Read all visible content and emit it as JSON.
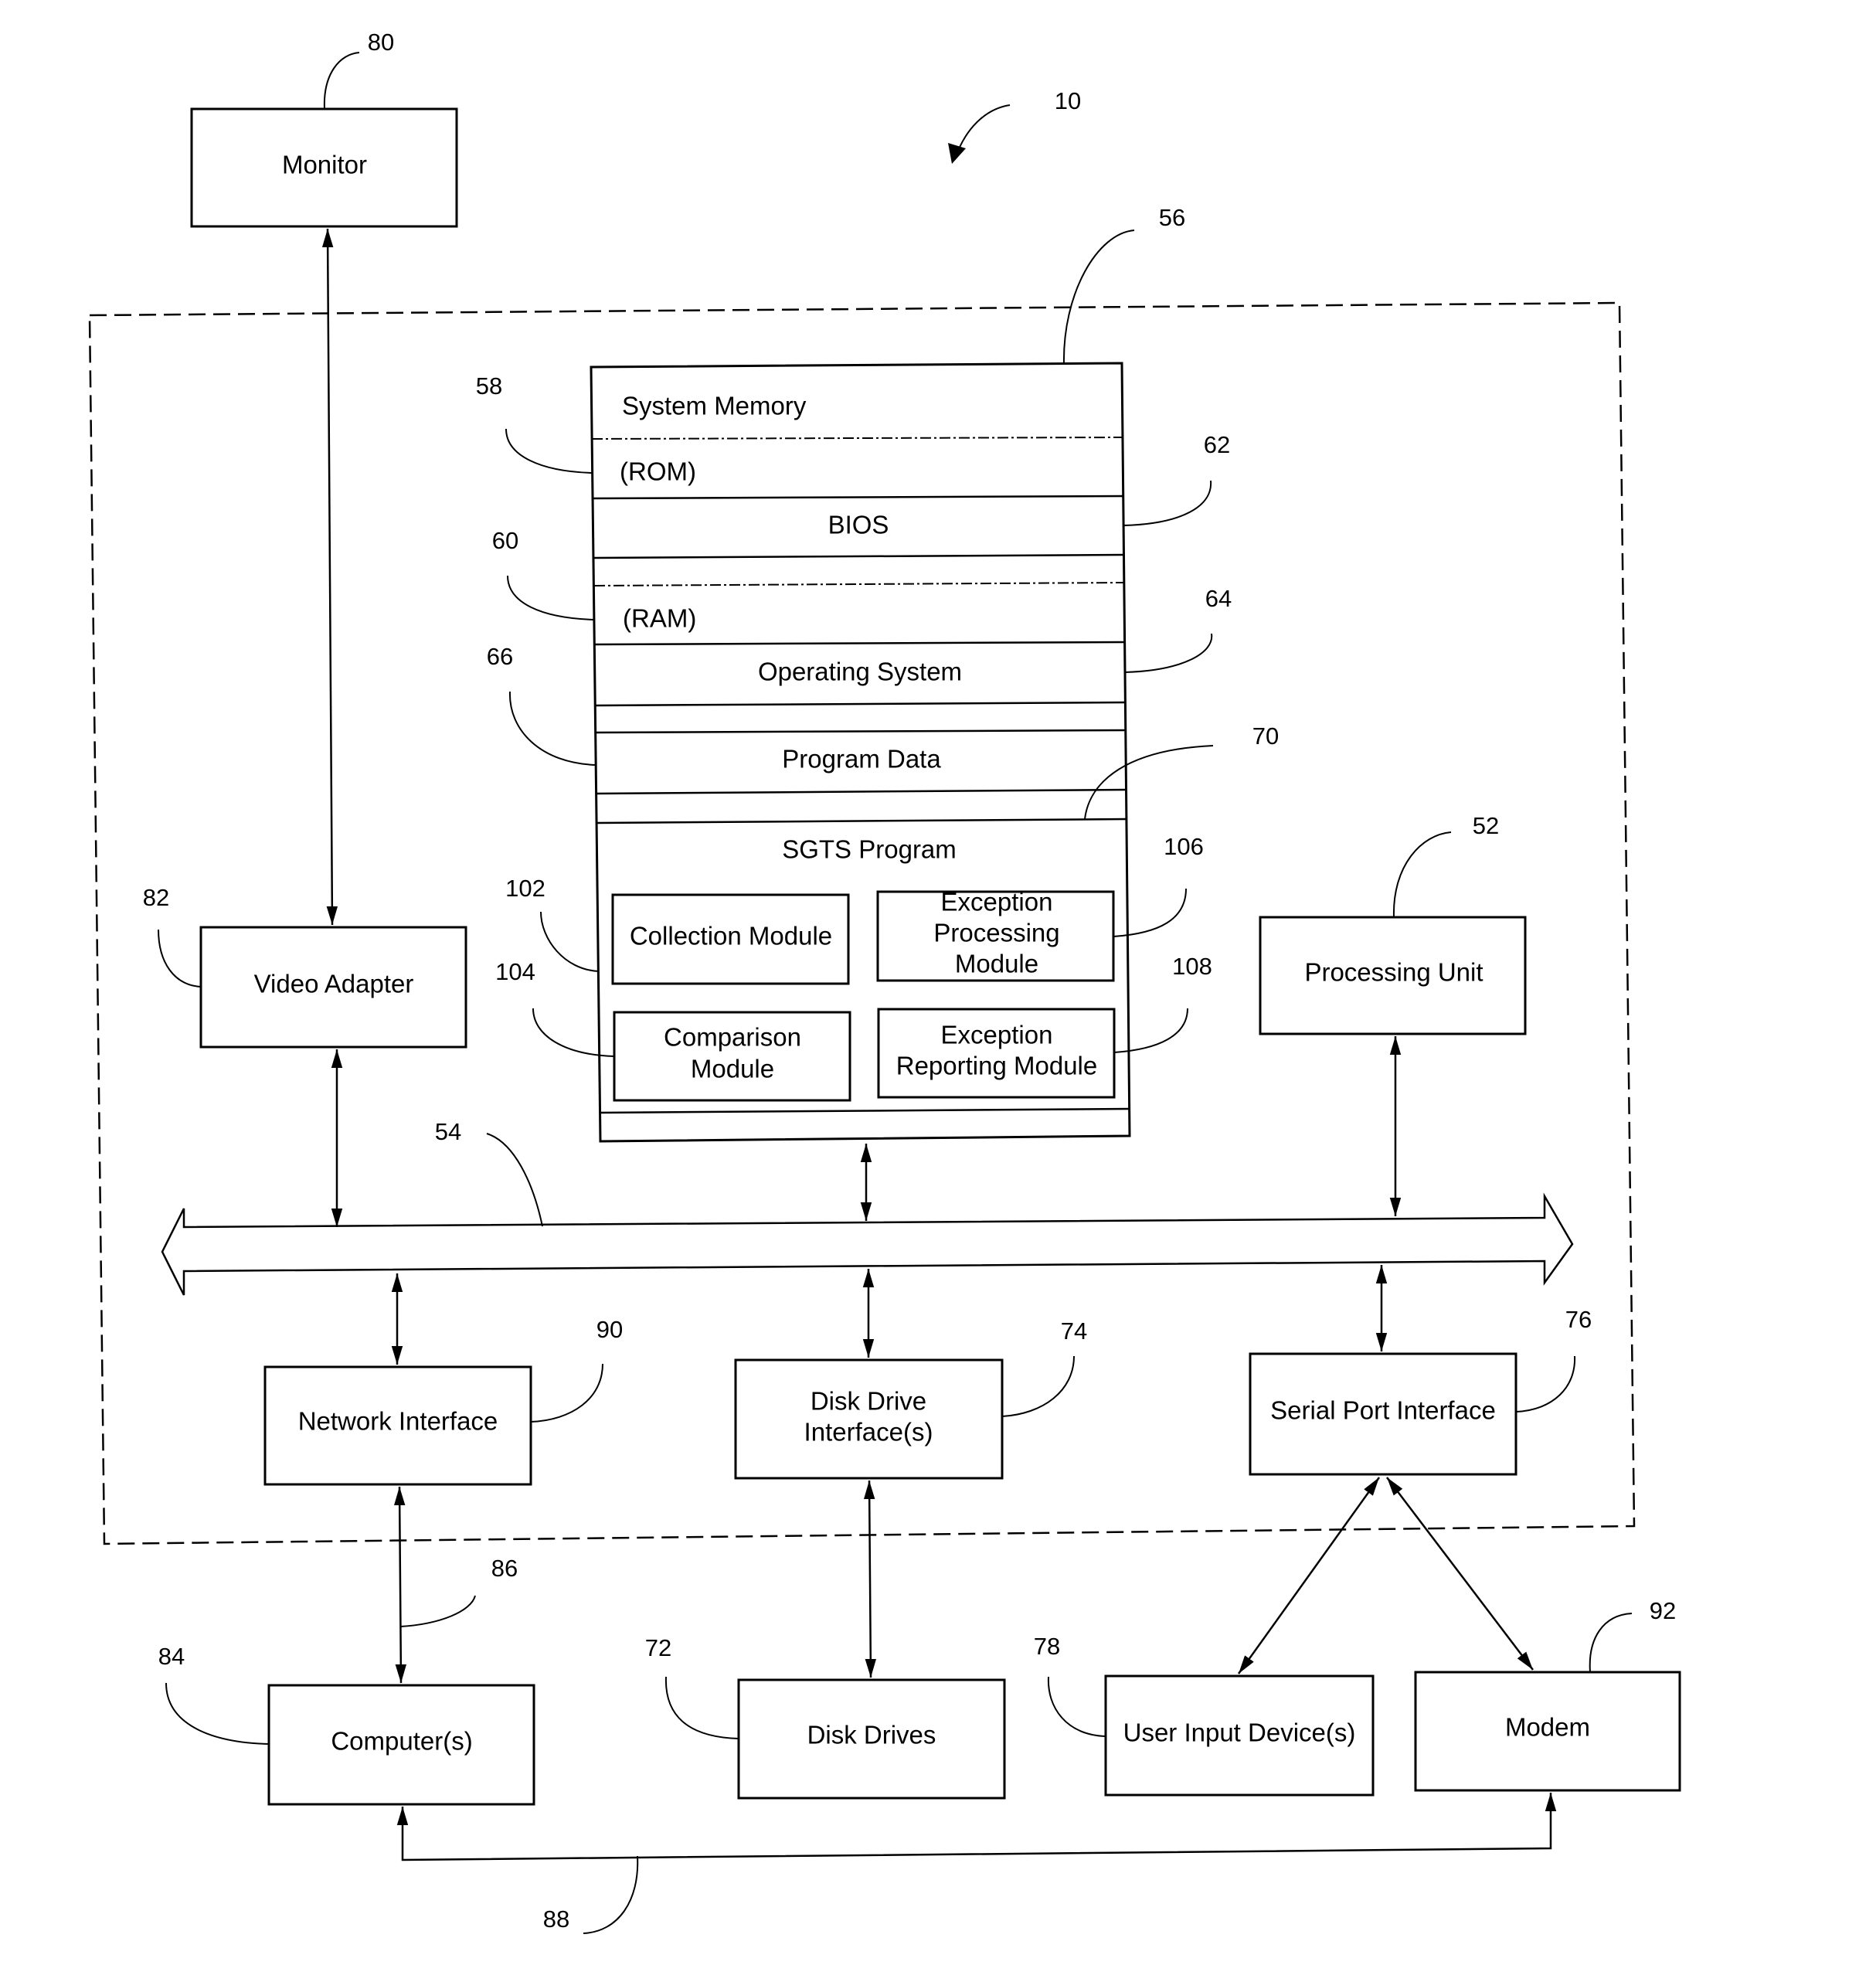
{
  "figure": {
    "ref": "10",
    "components": {
      "monitor": {
        "label": "Monitor",
        "ref": "80"
      },
      "video_adapter": {
        "label": "Video Adapter",
        "ref": "82"
      },
      "system_memory": {
        "label": "System Memory",
        "ref": "56",
        "rom": {
          "label": "(ROM)",
          "ref": "58"
        },
        "bios": {
          "label": "BIOS",
          "ref": "62"
        },
        "ram": {
          "label": "(RAM)",
          "ref": "60"
        },
        "operating_system": {
          "label": "Operating System",
          "ref": "64"
        },
        "program_data": {
          "label": "Program Data",
          "ref": "66"
        },
        "sgts_program": {
          "label": "SGTS Program",
          "ref": "70",
          "modules": {
            "collection": {
              "label": "Collection Module",
              "ref": "102"
            },
            "comparison": {
              "label_line1": "Comparison",
              "label_line2": "Module",
              "ref": "104"
            },
            "exception_processing": {
              "label_line1": "Exception",
              "label_line2": "Processing",
              "label_line3": "Module",
              "ref": "106"
            },
            "exception_reporting": {
              "label_line1": "Exception",
              "label_line2": "Reporting Module",
              "ref": "108"
            }
          }
        }
      },
      "processing_unit": {
        "label": "Processing Unit",
        "ref": "52"
      },
      "system_bus": {
        "ref": "54"
      },
      "network_interface": {
        "label": "Network Interface",
        "ref": "90"
      },
      "disk_drive_interface": {
        "label_line1": "Disk Drive",
        "label_line2": "Interface(s)",
        "ref": "74"
      },
      "serial_port_interface": {
        "label": "Serial Port Interface",
        "ref": "76"
      },
      "computers": {
        "label": "Computer(s)",
        "ref": "84"
      },
      "disk_drives": {
        "label": "Disk Drives",
        "ref": "72"
      },
      "user_input_devices": {
        "label": "User Input Device(s)",
        "ref": "78"
      },
      "modem": {
        "label": "Modem",
        "ref": "92"
      },
      "network_link": {
        "ref": "86"
      },
      "modem_link": {
        "ref": "88"
      }
    }
  }
}
